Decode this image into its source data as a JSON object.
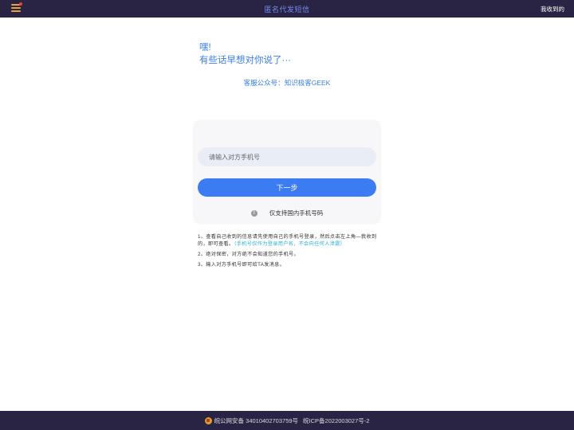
{
  "colors": {
    "topbar_bg": "#2a2444",
    "topbar_title": "#6f8cf0",
    "menu_bar": "#e8a23a",
    "menu_dot": "#e2463b",
    "greeting": "#3a7de8",
    "service": "#3a7de8",
    "input_bg": "#e9edf5",
    "button_bg": "#3b7cf2",
    "notes_highlight": "#2bb3d6"
  },
  "header": {
    "title": "匿名代发短信",
    "right_link": "我收到的"
  },
  "greeting": {
    "line1": "嘿!",
    "line2": "有些话早想对你说了···"
  },
  "service": {
    "label": "客服公众号：",
    "name": "知识极客GEEK"
  },
  "form": {
    "phone_placeholder": "请输入对方手机号",
    "next_label": "下一步",
    "hint_icon": "info-icon",
    "hint_text": "仅支持国内手机号码"
  },
  "notes": {
    "item1_text": "1、查看自己收到的信息请先使用自己的手机号登录，然后点击左上角—我收到的，即可查看。",
    "item1_highlight": "（手机号仅作为登录用户名，不会向任何人泄露）",
    "item2": "2、绝对保密，对方绝不会知道您的手机号。",
    "item3": "3、输入对方手机号即可给TA发消息。"
  },
  "footer": {
    "police_record": "皖公网安备 34010402703759号",
    "icp_record": "皖ICP备2022003027号-2"
  }
}
